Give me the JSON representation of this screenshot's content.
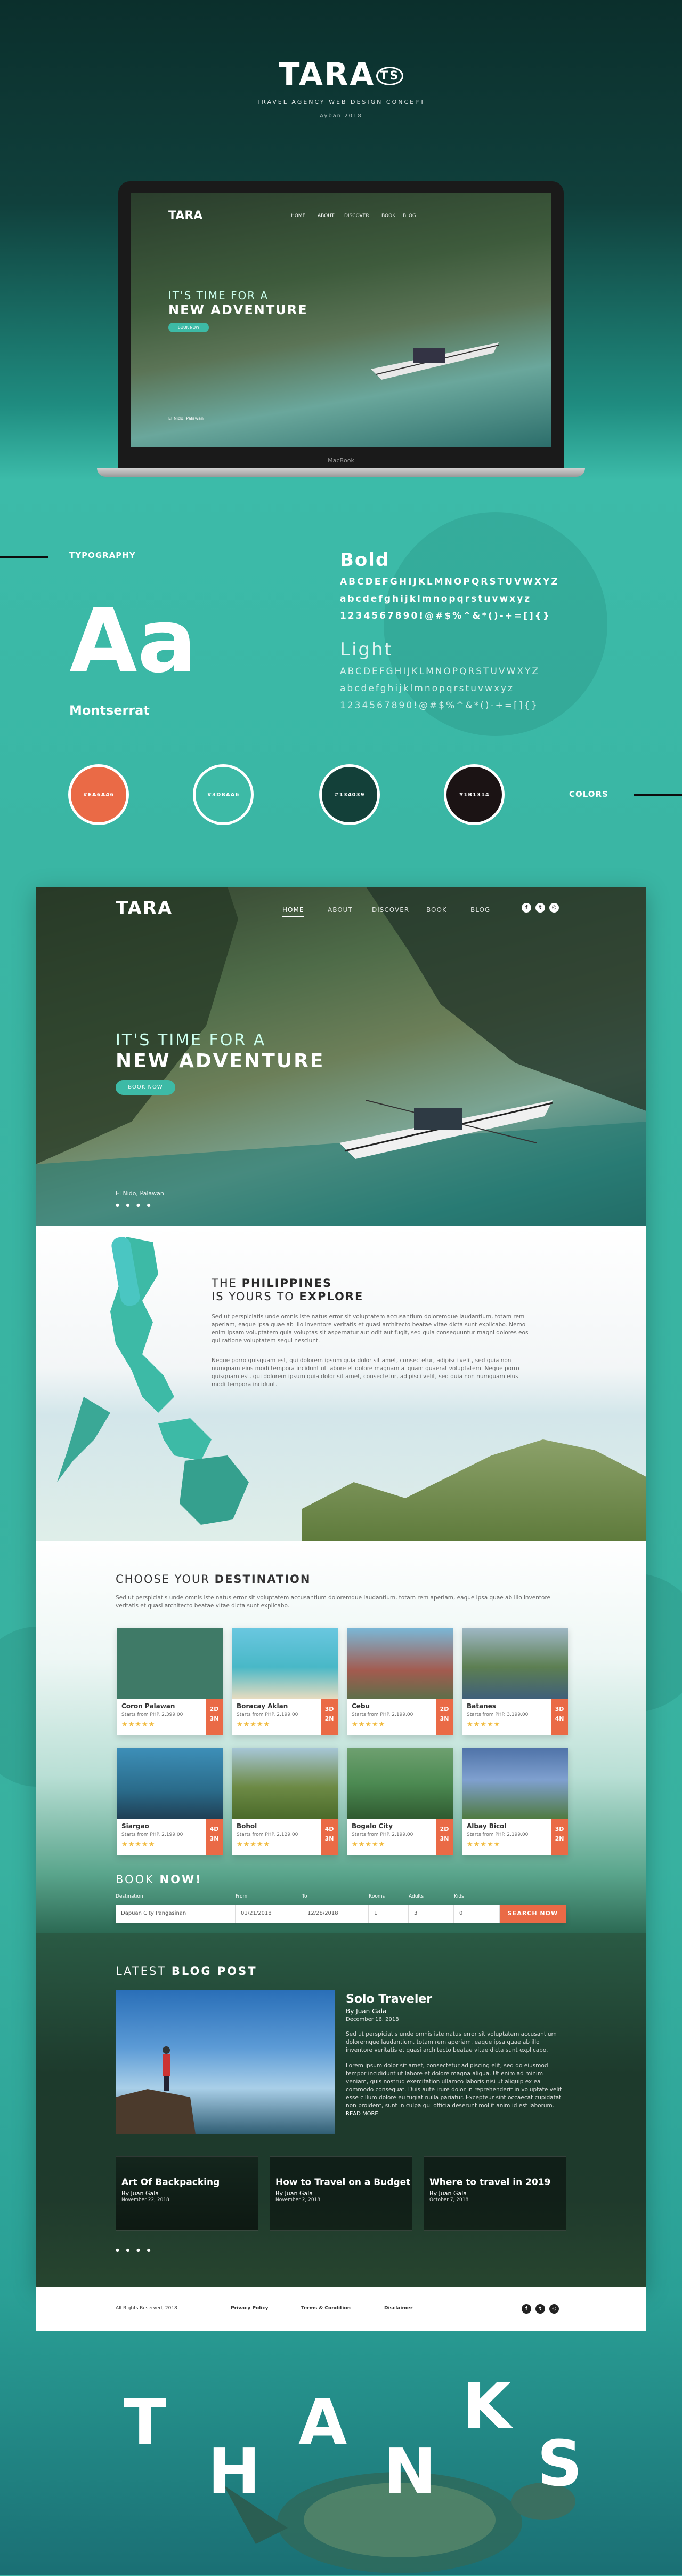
{
  "header": {
    "logo": "TARA",
    "logo_badge": "TS",
    "subtitle": "TRAVEL AGENCY WEB DESIGN CONCEPT",
    "date": "Ayban 2018"
  },
  "laptop": {
    "label": "MacBook",
    "nav": [
      "HOME",
      "ABOUT",
      "DISCOVER",
      "BOOK",
      "BLOG"
    ],
    "hero_small": "IT'S TIME FOR A",
    "hero_big": "NEW ADVENTURE",
    "hero_btn": "BOOK NOW",
    "location": "El Nido, Palawan"
  },
  "typography": {
    "label": "TYPOGRAPHY",
    "sample": "Aa",
    "font_name": "Montserrat",
    "bold_title": "Bold",
    "bold_upper": "ABCDEFGHIJKLMNOPQRSTUVWXYZ",
    "bold_lower": "abcdefghijklmnopqrstuvwxyz",
    "bold_nums": "1234567890!@#$%^&*()-+=[]{}",
    "light_title": "Light",
    "light_upper": "ABCDEFGHIJKLMNOPQRSTUVWXYZ",
    "light_lower": "abcdefghijklmnopqrstuvwxyz",
    "light_nums": "1234567890!@#$%^&*()-+=[]{}"
  },
  "colors": {
    "label": "COLORS",
    "swatches": [
      {
        "hex": "#EA6A46",
        "label": "#EA6A46"
      },
      {
        "hex": "#3DBAA6",
        "label": "#3DBAA6"
      },
      {
        "hex": "#134039",
        "label": "#134039"
      },
      {
        "hex": "#1B1314",
        "label": "#1B1314"
      }
    ]
  },
  "site": {
    "logo": "TARA",
    "nav": {
      "home": "HOME",
      "about": "ABOUT",
      "discover": "DISCOVER",
      "book": "BOOK",
      "blog": "BLOG"
    },
    "hero": {
      "small": "IT'S TIME FOR A",
      "big": "NEW ADVENTURE",
      "button": "BOOK NOW",
      "location": "El Nido, Palawan",
      "dots": "● ● ● ●"
    },
    "philippines": {
      "title1_pre": "THE ",
      "title1_bold": "PHILIPPINES",
      "title2_pre": "IS YOURS TO ",
      "title2_bold": "EXPLORE",
      "p1": "Sed ut perspiciatis unde omnis iste natus error sit voluptatem accusantium doloremque laudantium, totam rem aperiam, eaque ipsa quae ab illo inventore veritatis et quasi architecto beatae vitae dicta sunt explicabo. Nemo enim ipsam voluptatem quia voluptas sit aspernatur aut odit aut fugit, sed quia consequuntur magni dolores eos qui ratione voluptatem sequi nesciunt.",
      "p2": "Neque porro quisquam est, qui dolorem ipsum quia dolor sit amet, consectetur, adipisci velit, sed quia non numquam eius modi tempora incidunt ut labore et dolore magnam aliquam quaerat voluptatem. Neque porro quisquam est, qui dolorem ipsum quia dolor sit amet, consectetur, adipisci velit, sed quia non numquam eius modi tempora incidunt."
    },
    "destinations": {
      "title_pre": "CHOOSE YOUR ",
      "title_bold": "DESTINATION",
      "desc": "Sed ut perspiciatis unde omnis iste natus error sit voluptatem accusantium doloremque laudantium, totam rem aperiam, eaque ipsa quae ab illo inventore veritatis et quasi architecto beatae vitae dicta sunt explicabo.",
      "cards": [
        {
          "name": "Coron Palawan",
          "price": "Starts from PHP. 2,399.00",
          "stars": "★★★★★",
          "days": "2D",
          "nights": "3N",
          "color": "#3f7a67"
        },
        {
          "name": "Boracay Aklan",
          "price": "Starts from PHP. 2,199.00",
          "stars": "★★★★★",
          "days": "3D",
          "nights": "2N",
          "color": "#49b8c7"
        },
        {
          "name": "Cebu",
          "price": "Starts from PHP. 2,199.00",
          "stars": "★★★★★",
          "days": "2D",
          "nights": "3N",
          "color": "#a35b4f"
        },
        {
          "name": "Batanes",
          "price": "Starts from PHP. 3,199.00",
          "stars": "★★★★★",
          "days": "3D",
          "nights": "4N",
          "color": "#5d7f52"
        },
        {
          "name": "Siargao",
          "price": "Starts from PHP. 2,199.00",
          "stars": "★★★★★",
          "days": "4D",
          "nights": "3N",
          "color": "#3d8fb8"
        },
        {
          "name": "Bohol",
          "price": "Starts from PHP. 2,129.00",
          "stars": "★★★★★",
          "days": "4D",
          "nights": "3N",
          "color": "#6d8a45"
        },
        {
          "name": "Bogalo City",
          "price": "Starts from PHP. 2,199.00",
          "stars": "★★★★★",
          "days": "2D",
          "nights": "3N",
          "color": "#4c8a52"
        },
        {
          "name": "Albay Bicol",
          "price": "Starts from PHP. 2,199.00",
          "stars": "★★★★★",
          "days": "3D",
          "nights": "2N",
          "color": "#4f73a8"
        }
      ]
    },
    "book": {
      "title_pre": "BOOK ",
      "title_bold": "NOW!",
      "labels": {
        "destination": "Destination",
        "from": "From",
        "to": "To",
        "rooms": "Rooms",
        "adults": "Adults",
        "kids": "Kids"
      },
      "values": {
        "destination": "Dapuan City Pangasinan",
        "from": "01/21/2018",
        "to": "12/28/2018",
        "rooms": "1",
        "adults": "3",
        "kids": "0"
      },
      "button": "SEARCH NOW"
    },
    "blog": {
      "title_pre": "LATEST ",
      "title_bold": "BLOG POST",
      "post_title": "Solo Traveler",
      "post_by": "By Juan Gala",
      "post_date": "December 16, 2018",
      "post_p1": "Sed ut perspiciatis unde omnis iste natus error sit voluptatem accusantium doloremque laudantium, totam rem aperiam, eaque ipsa quae ab illo inventore veritatis et quasi architecto beatae vitae dicta sunt explicabo.",
      "post_p2": "Lorem ipsum dolor sit amet, consectetur adipiscing elit, sed do eiusmod tempor incididunt ut labore et dolore magna aliqua. Ut enim ad minim veniam, quis nostrud exercitation ullamco laboris nisi ut aliquip ex ea commodo consequat. Duis aute irure dolor in reprehenderit in voluptate velit esse cillum dolore eu fugiat nulla pariatur. Excepteur sint occaecat cupidatat non proident, sunt in culpa qui officia deserunt mollit anim id est laborum.",
      "read_more": "READ MORE",
      "mini": [
        {
          "title": "Art Of Backpacking",
          "by": "By Juan Gala",
          "date": "November 22, 2018"
        },
        {
          "title": "How to Travel on a Budget",
          "by": "By Juan Gala",
          "date": "November 2, 2018"
        },
        {
          "title": "Where to travel in 2019",
          "by": "By Juan Gala",
          "date": "October 7, 2018"
        }
      ],
      "dots": "● ● ● ●"
    },
    "footer": {
      "copyright": "All Rights Reserved, 2018",
      "privacy": "Privacy Policy",
      "terms": "Terms & Condition",
      "disclaimer": "Disclaimer"
    }
  },
  "thanks": {
    "t": "T",
    "h": "H",
    "a": "A",
    "n": "N",
    "k": "K",
    "s": "S"
  }
}
